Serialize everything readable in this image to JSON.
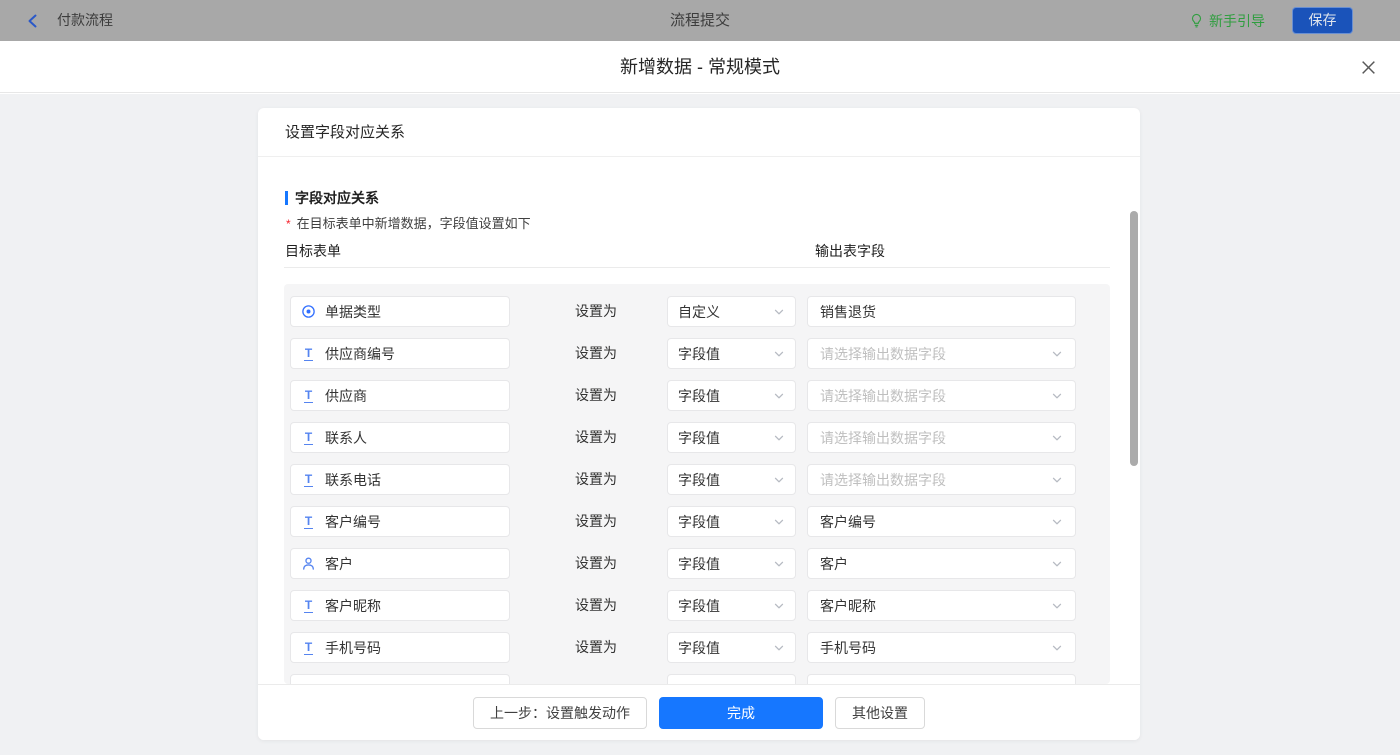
{
  "topbar": {
    "back_label": "付款流程",
    "center_title": "流程提交",
    "guide_label": "新手引导",
    "save_label": "保存"
  },
  "modal": {
    "title": "新增数据 - 常规模式"
  },
  "card": {
    "header": "设置字段对应关系",
    "section_title": "字段对应关系",
    "required_note": "在目标表单中新增数据，字段值设置如下",
    "col_left": "目标表单",
    "col_right": "输出表字段",
    "set_label": "设置为",
    "rows": [
      {
        "icon": "radio",
        "field": "单据类型",
        "mode": "自定义",
        "output": "销售退货",
        "kind": "input"
      },
      {
        "icon": "text",
        "field": "供应商编号",
        "mode": "字段值",
        "output": "",
        "placeholder": "请选择输出数据字段",
        "kind": "select-ph"
      },
      {
        "icon": "text",
        "field": "供应商",
        "mode": "字段值",
        "output": "",
        "placeholder": "请选择输出数据字段",
        "kind": "select-ph"
      },
      {
        "icon": "text",
        "field": "联系人",
        "mode": "字段值",
        "output": "",
        "placeholder": "请选择输出数据字段",
        "kind": "select-ph"
      },
      {
        "icon": "text",
        "field": "联系电话",
        "mode": "字段值",
        "output": "",
        "placeholder": "请选择输出数据字段",
        "kind": "select-ph"
      },
      {
        "icon": "text",
        "field": "客户编号",
        "mode": "字段值",
        "output": "客户编号",
        "kind": "select"
      },
      {
        "icon": "person",
        "field": "客户",
        "mode": "字段值",
        "output": "客户",
        "kind": "select"
      },
      {
        "icon": "text",
        "field": "客户昵称",
        "mode": "字段值",
        "output": "客户昵称",
        "kind": "select"
      },
      {
        "icon": "text",
        "field": "手机号码",
        "mode": "字段值",
        "output": "手机号码",
        "kind": "select"
      },
      {
        "icon": "",
        "field": "",
        "mode": "",
        "output": "",
        "kind": "empty"
      }
    ],
    "footer": {
      "prev_label": "上一步：设置触发动作",
      "done_label": "完成",
      "other_label": "其他设置"
    }
  },
  "colors": {
    "primary": "#1677ff",
    "save_button_bg": "#1a53ba",
    "guide_green": "#2f9e3f",
    "field_icon_blue": "#5584f0"
  }
}
